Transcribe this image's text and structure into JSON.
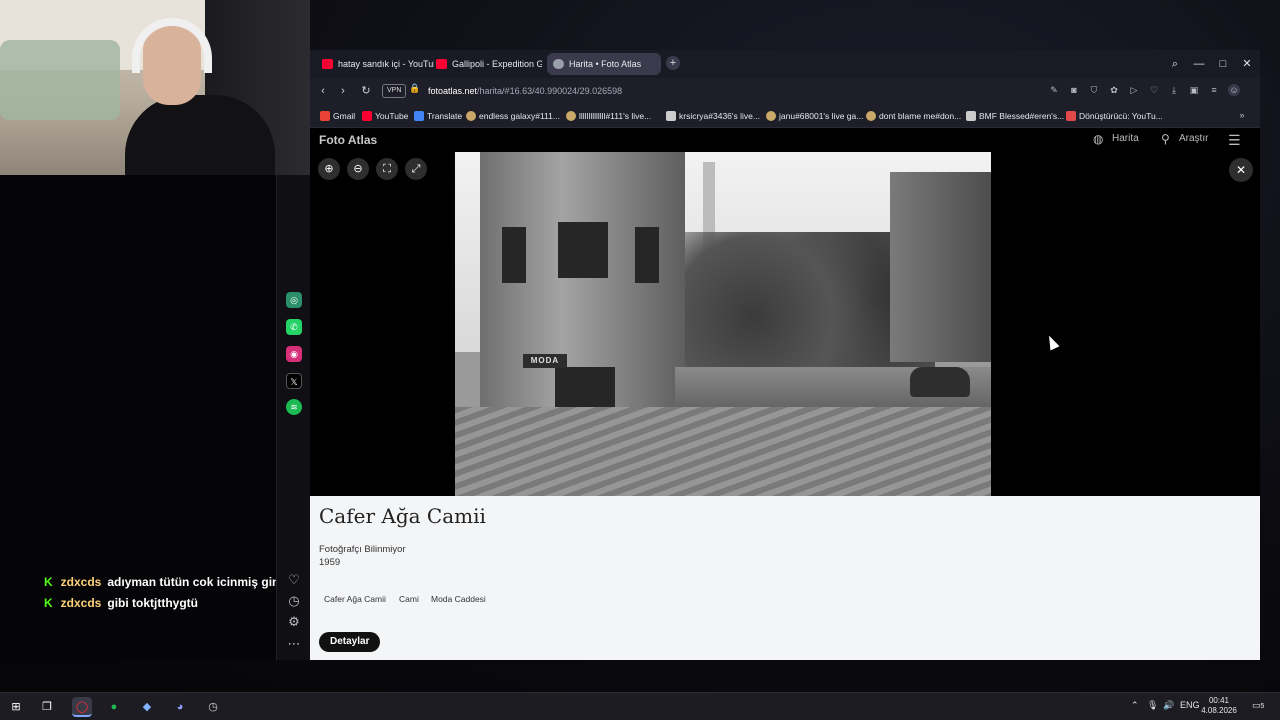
{
  "chat": {
    "messages": [
      {
        "badge": "K",
        "user": "zdxcds",
        "text": "adıyman tütün cok icinmiş gini"
      },
      {
        "badge": "K",
        "user": "zdxcds",
        "text": "gibi toktjtthygtü"
      }
    ]
  },
  "browser": {
    "tabs": [
      {
        "label": "hatay sandık içi - YouTube",
        "favicon_color": "#ff0033"
      },
      {
        "label": "Gallipoli - Expedition Gam",
        "favicon_color": "#ff0033"
      },
      {
        "label": "Harita • Foto Atlas",
        "favicon_color": "#9aa0aa",
        "active": true
      }
    ],
    "vpn_label": "VPN",
    "url_host": "fotoatlas.net",
    "url_path": "/harita/#16.63/40.990024/29.026598",
    "bookmarks": [
      {
        "label": "Gmail",
        "icon_color": "#ea4335"
      },
      {
        "label": "YouTube",
        "icon_color": "#ff0033"
      },
      {
        "label": "Translate",
        "icon_color": "#4285f4"
      },
      {
        "label": "endless galaxy#111...",
        "icon_color": "#c9a86a"
      },
      {
        "label": "llllllllllllll#111's live...",
        "icon_color": "#c9a86a"
      },
      {
        "label": "krsicrya#3436's live...",
        "icon_color": "#cccccc"
      },
      {
        "label": "janu#68001's live ga...",
        "icon_color": "#c9a86a"
      },
      {
        "label": "dont blame me#don...",
        "icon_color": "#c9a86a"
      },
      {
        "label": "BMF Blessed#eren's...",
        "icon_color": "#cccccc"
      },
      {
        "label": "Dönüştürücü: YouTu...",
        "icon_color": "#e24a4a"
      }
    ]
  },
  "site": {
    "logo": "Foto Atlas",
    "nav_map": "Harita",
    "nav_search": "Araştır",
    "photo_sign": "MODA",
    "title": "Cafer Ağa Camii",
    "photographer": "Fotoğrafçı Bilinmiyor",
    "year": "1959",
    "tags": [
      "Cafer Ağa Camii",
      "Cami",
      "Moda Caddesi"
    ],
    "details_button": "Detaylar"
  },
  "taskbar": {
    "language": "ENG",
    "time": "00:41",
    "date": "4.08.2026",
    "notification_count": "5"
  }
}
